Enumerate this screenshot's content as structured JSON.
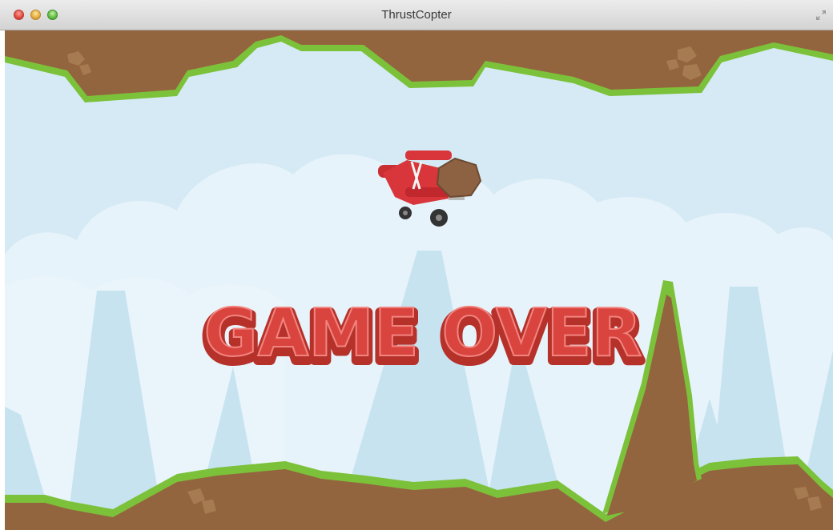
{
  "window": {
    "title": "ThrustCopter"
  },
  "game": {
    "status_text": "GAME OVER",
    "colors": {
      "sky": "#d5eaf5",
      "cloud": "#e9f4fa",
      "mountain": "#c9e4f0",
      "ground": "#93653f",
      "grass": "#7cc13a",
      "rock": "#8d6242",
      "text_fill": "#d9443f",
      "text_outline": "#b53129",
      "plane": "#d8363a"
    }
  }
}
